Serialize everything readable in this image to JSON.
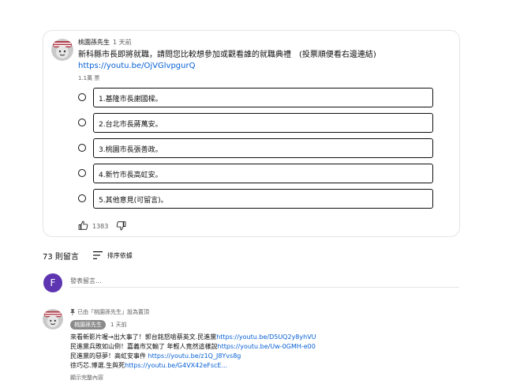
{
  "post": {
    "author": "桃園孫先生",
    "time": "1 天前",
    "text": "新科縣市長即將就職，請問您比較想參加或觀看誰的就職典禮　(投票順便看右邊連結)",
    "link": "https://youtu.be/OjVGlvpgurQ",
    "vote_count": "1.1萬 票",
    "options": [
      "1.基隆市長謝國樑。",
      "2.台北市長蔣萬安。",
      "3.桃園市長張善政。",
      "4.新竹市長高虹安。",
      "5.其他意見(可留言)。"
    ],
    "likes": "1383"
  },
  "comments": {
    "count": "73 則留言",
    "sort_label": "排序依據",
    "user_initial": "F",
    "add_placeholder": "發表留言...",
    "pinned": {
      "pinned_label": "已由「桃園孫先生」設為置頂",
      "author": "桃園孫先生",
      "time": "1 天前",
      "lines": [
        {
          "text": "來看新影片喔→出大事了！郭台銘怒嗆蔡英文.民進黨",
          "link": "https://youtu.be/D5UQ2y8yhVU"
        },
        {
          "text": "民進黨兵敗如山倒！嘉義市又輸了 年輕人竟然這樣說",
          "link": "https://youtu.be/Uw-0GMH-e00"
        },
        {
          "text": "民進黨的惡夢！高虹安事件 ",
          "link": "https://youtu.be/z1Q_J8Yvs8g"
        },
        {
          "text": "徐巧芯.博選.生與死",
          "link": "https://youtu.be/G4VX42eFscE..."
        }
      ],
      "show_more": "顯示完整內容"
    }
  }
}
